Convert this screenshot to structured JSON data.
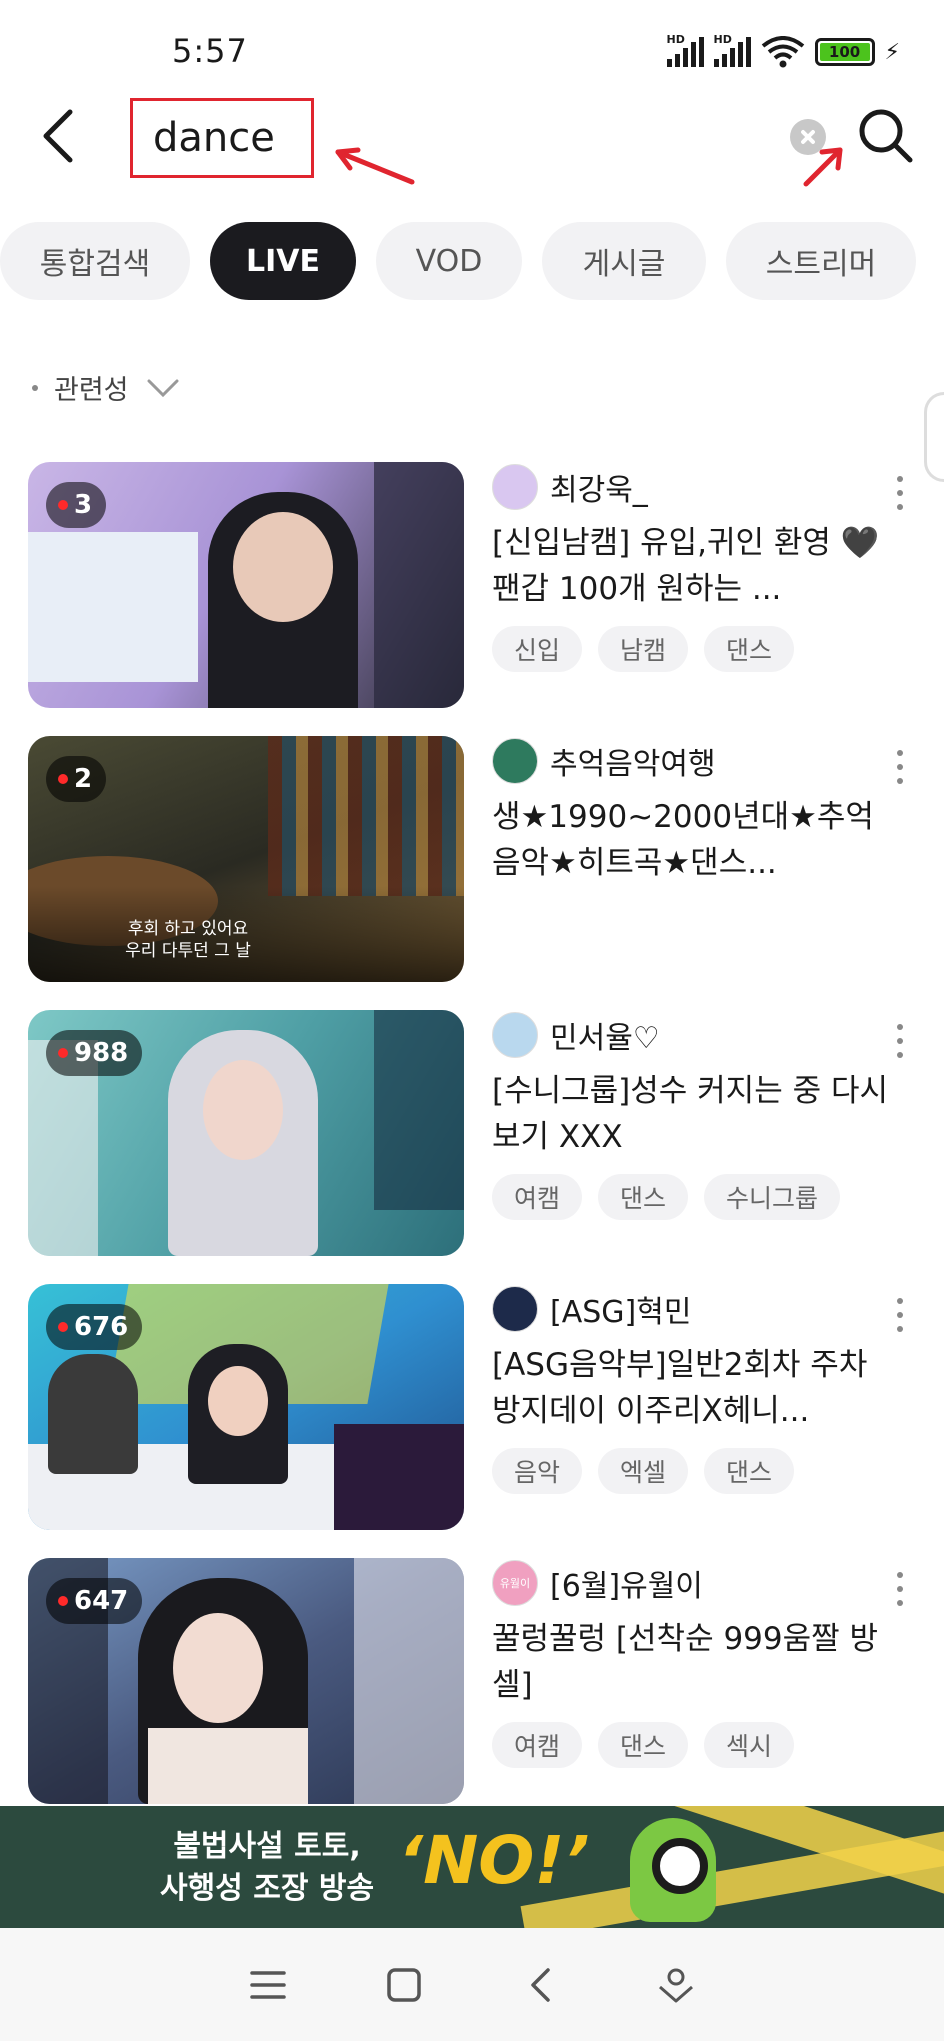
{
  "status_bar": {
    "time": "5:57",
    "hd_label": "HD",
    "battery": "100"
  },
  "search": {
    "query": "dance"
  },
  "tabs": [
    {
      "label": "통합검색",
      "active": false
    },
    {
      "label": "LIVE",
      "active": true
    },
    {
      "label": "VOD",
      "active": false
    },
    {
      "label": "게시글",
      "active": false
    },
    {
      "label": "스트리머",
      "active": false
    }
  ],
  "sort": {
    "label": "관련성"
  },
  "results": [
    {
      "viewers": "3",
      "channel": "최강욱_",
      "title": "[신입남캠] 유입,귀인 환영 🖤 팬갑 100개 원하는 ...",
      "tags": [
        "신입",
        "남캠",
        "댄스"
      ],
      "thumb_colors": [
        "#c9b6e6",
        "#2b2b36"
      ],
      "avatar_color": "#d9c7f0"
    },
    {
      "viewers": "2",
      "channel": "추억음악여행",
      "title": "생★1990~2000년대★추억음악★히트곡★댄스...",
      "tags": [],
      "thumb_colors": [
        "#3a3a2a",
        "#8a6a3a"
      ],
      "avatar_color": "#2e7a5e",
      "thumb_caption_1": "후회 하고 있어요",
      "thumb_caption_2": "우리 다투던 그 날"
    },
    {
      "viewers": "988",
      "channel": "민서율♡",
      "title": "[수니그룹]성수 커지는 중 다시보기 XXX",
      "tags": [
        "여캠",
        "댄스",
        "수니그룹"
      ],
      "thumb_colors": [
        "#5fb3b3",
        "#2d6f7a"
      ],
      "avatar_color": "#b9d8ee"
    },
    {
      "viewers": "676",
      "channel": "[ASG]혁민",
      "title": "[ASG음악부]일반2회차 주차방지데이 이주리X헤니...",
      "tags": [
        "음악",
        "엑셀",
        "댄스"
      ],
      "thumb_colors": [
        "#37c1d6",
        "#1f4f8a"
      ],
      "avatar_color": "#1d2a4a"
    },
    {
      "viewers": "647",
      "channel": "[6월]유월이",
      "title": "꿀렁꿀렁 [선착순 999움짤 방셀]",
      "tags": [
        "여캠",
        "댄스",
        "섹시"
      ],
      "thumb_colors": [
        "#7a9cc8",
        "#2a3550"
      ],
      "avatar_color": "#f0a0c0",
      "avatar_text": "유월이"
    }
  ],
  "banner": {
    "line1": "불법사설 토토,",
    "line2": "사행성 조장 방송",
    "emphasis": "‘NO!’"
  }
}
